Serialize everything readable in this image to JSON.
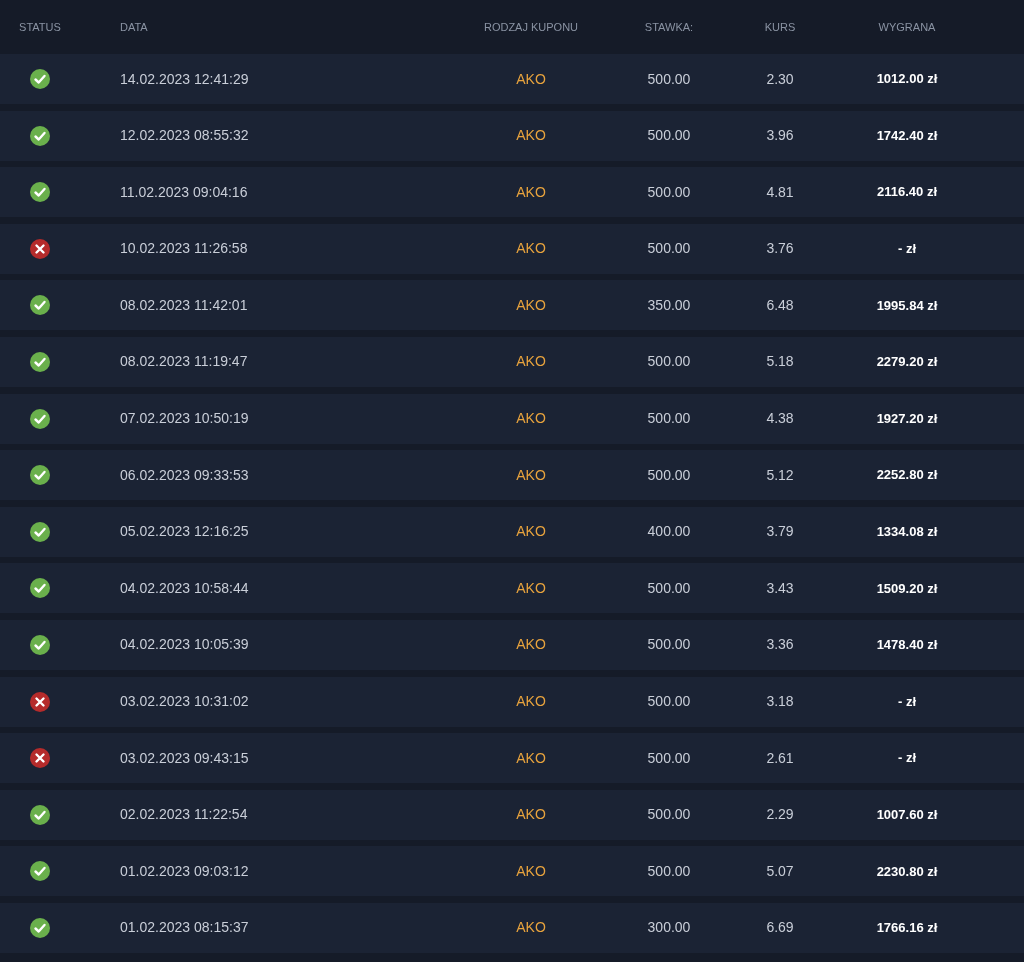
{
  "columns": [
    "STATUS",
    "DATA",
    "RODZAJ KUPONU",
    "STAWKA:",
    "KURS",
    "WYGRANA"
  ],
  "rows": [
    {
      "kind": "won",
      "date": "14.02.2023 12:41:29",
      "type": "AKO",
      "stake": "500.00",
      "odds": "2.30",
      "payout": "1012.00 zł"
    },
    {
      "kind": "won",
      "date": "12.02.2023 08:55:32",
      "type": "AKO",
      "stake": "500.00",
      "odds": "3.96",
      "payout": "1742.40 zł"
    },
    {
      "kind": "won",
      "date": "11.02.2023 09:04:16",
      "type": "AKO",
      "stake": "500.00",
      "odds": "4.81",
      "payout": "2116.40 zł"
    },
    {
      "kind": "lost",
      "date": "10.02.2023 11:26:58",
      "type": "AKO",
      "stake": "500.00",
      "odds": "3.76",
      "payout": "- zł"
    },
    {
      "kind": "won",
      "date": "08.02.2023 11:42:01",
      "type": "AKO",
      "stake": "350.00",
      "odds": "6.48",
      "payout": "1995.84 zł"
    },
    {
      "kind": "won",
      "date": "08.02.2023 11:19:47",
      "type": "AKO",
      "stake": "500.00",
      "odds": "5.18",
      "payout": "2279.20 zł"
    },
    {
      "kind": "won",
      "date": "07.02.2023 10:50:19",
      "type": "AKO",
      "stake": "500.00",
      "odds": "4.38",
      "payout": "1927.20 zł"
    },
    {
      "kind": "won",
      "date": "06.02.2023 09:33:53",
      "type": "AKO",
      "stake": "500.00",
      "odds": "5.12",
      "payout": "2252.80 zł"
    },
    {
      "kind": "won",
      "date": "05.02.2023 12:16:25",
      "type": "AKO",
      "stake": "400.00",
      "odds": "3.79",
      "payout": "1334.08 zł"
    },
    {
      "kind": "won",
      "date": "04.02.2023 10:58:44",
      "type": "AKO",
      "stake": "500.00",
      "odds": "3.43",
      "payout": "1509.20 zł"
    },
    {
      "kind": "won",
      "date": "04.02.2023 10:05:39",
      "type": "AKO",
      "stake": "500.00",
      "odds": "3.36",
      "payout": "1478.40 zł"
    },
    {
      "kind": "lost",
      "date": "03.02.2023 10:31:02",
      "type": "AKO",
      "stake": "500.00",
      "odds": "3.18",
      "payout": "- zł"
    },
    {
      "kind": "lost",
      "date": "03.02.2023 09:43:15",
      "type": "AKO",
      "stake": "500.00",
      "odds": "2.61",
      "payout": "- zł"
    },
    {
      "kind": "won",
      "date": "02.02.2023 11:22:54",
      "type": "AKO",
      "stake": "500.00",
      "odds": "2.29",
      "payout": "1007.60 zł"
    },
    {
      "kind": "won",
      "date": "01.02.2023 09:03:12",
      "type": "AKO",
      "stake": "500.00",
      "odds": "5.07",
      "payout": "2230.80 zł"
    },
    {
      "kind": "won",
      "date": "01.02.2023 08:15:37",
      "type": "AKO",
      "stake": "300.00",
      "odds": "6.69",
      "payout": "1766.16 zł"
    }
  ]
}
